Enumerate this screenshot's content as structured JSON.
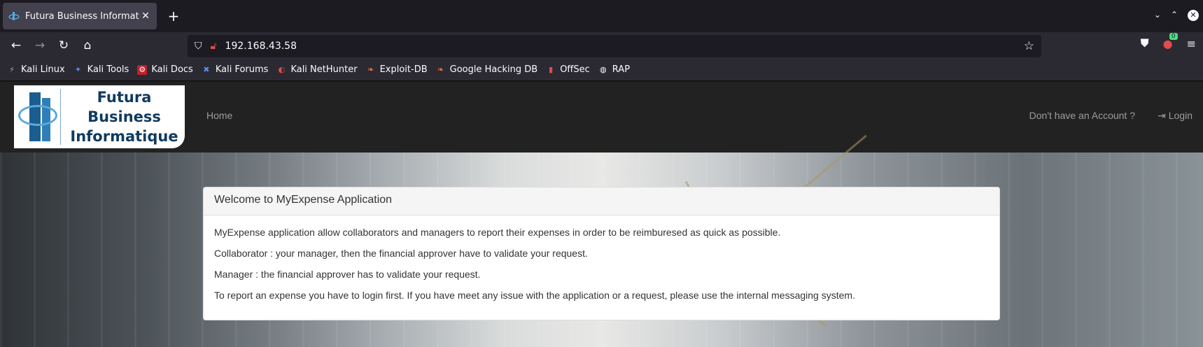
{
  "browser": {
    "tab_title": "Futura Business Informatique",
    "url": "192.168.43.58",
    "downloads_badge": "0",
    "bookmarks": [
      {
        "label": "Kali Linux",
        "icon": "kali-icon"
      },
      {
        "label": "Kali Tools",
        "icon": "kali-tools-icon"
      },
      {
        "label": "Kali Docs",
        "icon": "kali-docs-icon"
      },
      {
        "label": "Kali Forums",
        "icon": "kali-forums-icon"
      },
      {
        "label": "Kali NetHunter",
        "icon": "nethunter-icon"
      },
      {
        "label": "Exploit-DB",
        "icon": "exploitdb-icon"
      },
      {
        "label": "Google Hacking DB",
        "icon": "ghdb-icon"
      },
      {
        "label": "OffSec",
        "icon": "offsec-icon"
      },
      {
        "label": "RAP",
        "icon": "globe-icon"
      }
    ]
  },
  "site": {
    "logo_line1": "Futura Business",
    "logo_line2": "Informatique",
    "nav_home": "Home",
    "nav_signup": "Don't have an Account ?",
    "nav_login": "Login"
  },
  "panel": {
    "heading": "Welcome to MyExpense Application",
    "paragraphs": [
      "MyExpense application allow collaborators and managers to report their expenses in order to be reimburesed as quick as possible.",
      "Collaborator : your manager, then the financial approver have to validate your request.",
      "Manager : the financial approver has to validate your request.",
      "To report an expense you have to login first. If you have meet any issue with the application or a request, please use the internal messaging system."
    ]
  }
}
